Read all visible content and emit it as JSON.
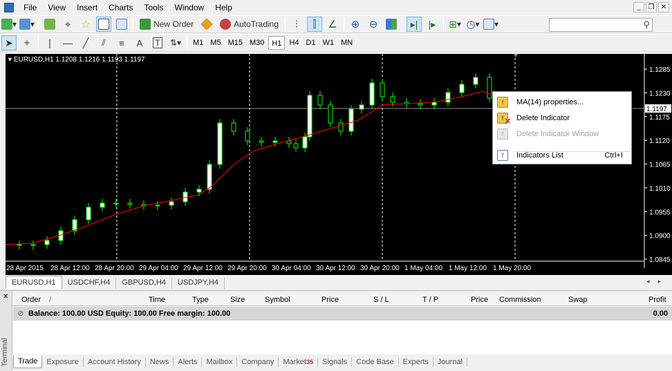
{
  "menubar": {
    "items": [
      "File",
      "View",
      "Insert",
      "Charts",
      "Tools",
      "Window",
      "Help"
    ]
  },
  "toolbar": {
    "new_order": "New Order",
    "autotrading": "AutoTrading"
  },
  "timeframes": {
    "items": [
      "M1",
      "M5",
      "M15",
      "M30",
      "H1",
      "H4",
      "D1",
      "W1",
      "MN"
    ],
    "active": "H1"
  },
  "search": {
    "placeholder": ""
  },
  "chart": {
    "info": "EURUSD,H1  1.1208 1.1216 1.1193 1.1197",
    "price_ticks": [
      "1.1285",
      "1.1230",
      "1.1175",
      "1.1120",
      "1.1065",
      "1.1010",
      "1.0955",
      "1.0900",
      "1.0845"
    ],
    "current_price": "1.1197",
    "time_ticks": [
      "28 Apr 2015",
      "28 Apr 12:00",
      "28 Apr 20:00",
      "29 Apr 04:00",
      "29 Apr 12:00",
      "29 Apr 20:00",
      "30 Apr 04:00",
      "30 Apr 12:00",
      "30 Apr 20:00",
      "1 May 04:00",
      "1 May 12:00",
      "1 May 20:00"
    ],
    "colors": {
      "background": "#000000",
      "candle_up": "#ffffff",
      "candle_down": "#000000",
      "wick": "#00ff00",
      "ma_line": "#ff0000",
      "grid": "#ffffff"
    }
  },
  "context_menu": {
    "items": [
      {
        "label": "MA(14) properties...",
        "icon": "indicator-properties-icon",
        "enabled": true,
        "shortcut": ""
      },
      {
        "label": "Delete Indicator",
        "icon": "delete-indicator-icon",
        "enabled": true,
        "shortcut": ""
      },
      {
        "label": "Delete Indicator Window",
        "icon": "delete-window-icon",
        "enabled": false,
        "shortcut": ""
      },
      {
        "label": "Indicators List",
        "icon": "indicators-list-icon",
        "enabled": true,
        "shortcut": "Ctrl+I"
      }
    ]
  },
  "chart_tabs": [
    "EURUSD,H1",
    "USDCHF,H4",
    "GBPUSD,H4",
    "USDJPY,H4"
  ],
  "terminal": {
    "side_label": "Terminal",
    "columns": [
      "Order",
      "/",
      "Time",
      "Type",
      "Size",
      "Symbol",
      "Price",
      "S / L",
      "T / P",
      "Price",
      "Commission",
      "Swap",
      "Profit"
    ],
    "balance_line": "Balance: 100.00 USD  Equity: 100.00  Free margin: 100.00",
    "balance_profit": "0.00",
    "tabs": [
      {
        "label": "Trade",
        "badge": ""
      },
      {
        "label": "Exposure",
        "badge": ""
      },
      {
        "label": "Account History",
        "badge": ""
      },
      {
        "label": "News",
        "badge": ""
      },
      {
        "label": "Alerts",
        "badge": ""
      },
      {
        "label": "Mailbox",
        "badge": ""
      },
      {
        "label": "Company",
        "badge": ""
      },
      {
        "label": "Market",
        "badge": "35"
      },
      {
        "label": "Signals",
        "badge": ""
      },
      {
        "label": "Code Base",
        "badge": ""
      },
      {
        "label": "Experts",
        "badge": ""
      },
      {
        "label": "Journal",
        "badge": ""
      }
    ]
  }
}
